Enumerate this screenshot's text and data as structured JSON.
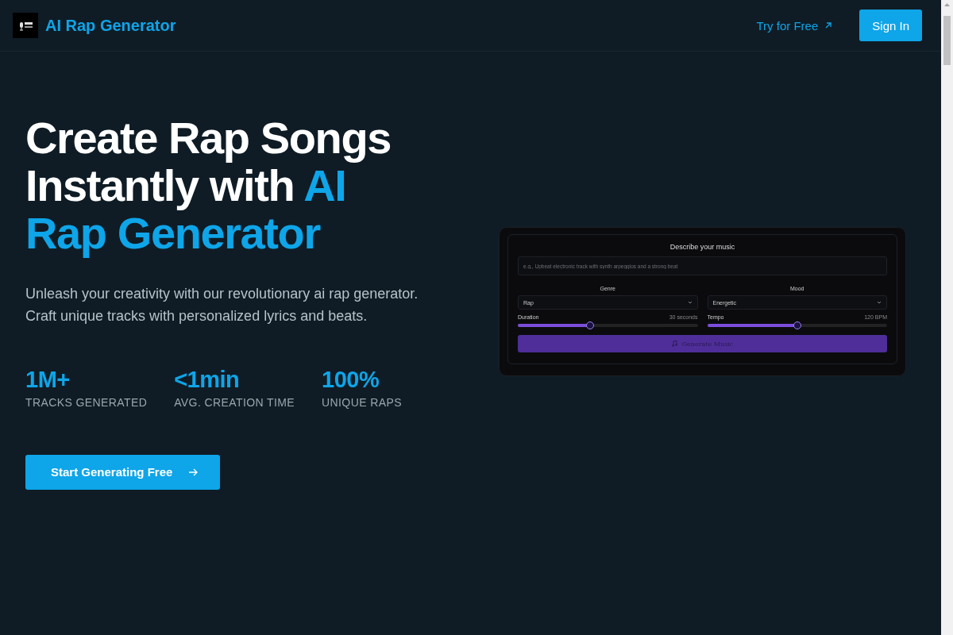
{
  "header": {
    "brand": "AI Rap Generator",
    "try_link": "Try for Free",
    "sign_in": "Sign In"
  },
  "hero": {
    "title": "Create Rap Songs Instantly with",
    "title_highlight": "AI Rap Generator",
    "description_lines": [
      "Unleash your creativity with our revolutionary ai rap generator.",
      "Craft unique tracks with personalized lyrics and beats."
    ],
    "stats": [
      {
        "value": "1M+",
        "label": "TRACKS GENERATED"
      },
      {
        "value": "<1min",
        "label": "AVG. CREATION TIME"
      },
      {
        "value": "100%",
        "label": "UNIQUE RAPS"
      }
    ],
    "cta": "Start Generating Free"
  },
  "preview": {
    "heading": "Describe your music",
    "placeholder": "e.g., Upbeat electronic track with synth arpeggios and a strong beat",
    "selects": [
      {
        "label": "Genre",
        "value": "Rap"
      },
      {
        "label": "Mood",
        "value": "Energetic"
      }
    ],
    "sliders": [
      {
        "label": "Duration",
        "reading": "30 seconds",
        "level": 0.4
      },
      {
        "label": "Tempo",
        "reading": "120 BPM",
        "level": 0.5
      }
    ],
    "button": "Generate Music"
  }
}
